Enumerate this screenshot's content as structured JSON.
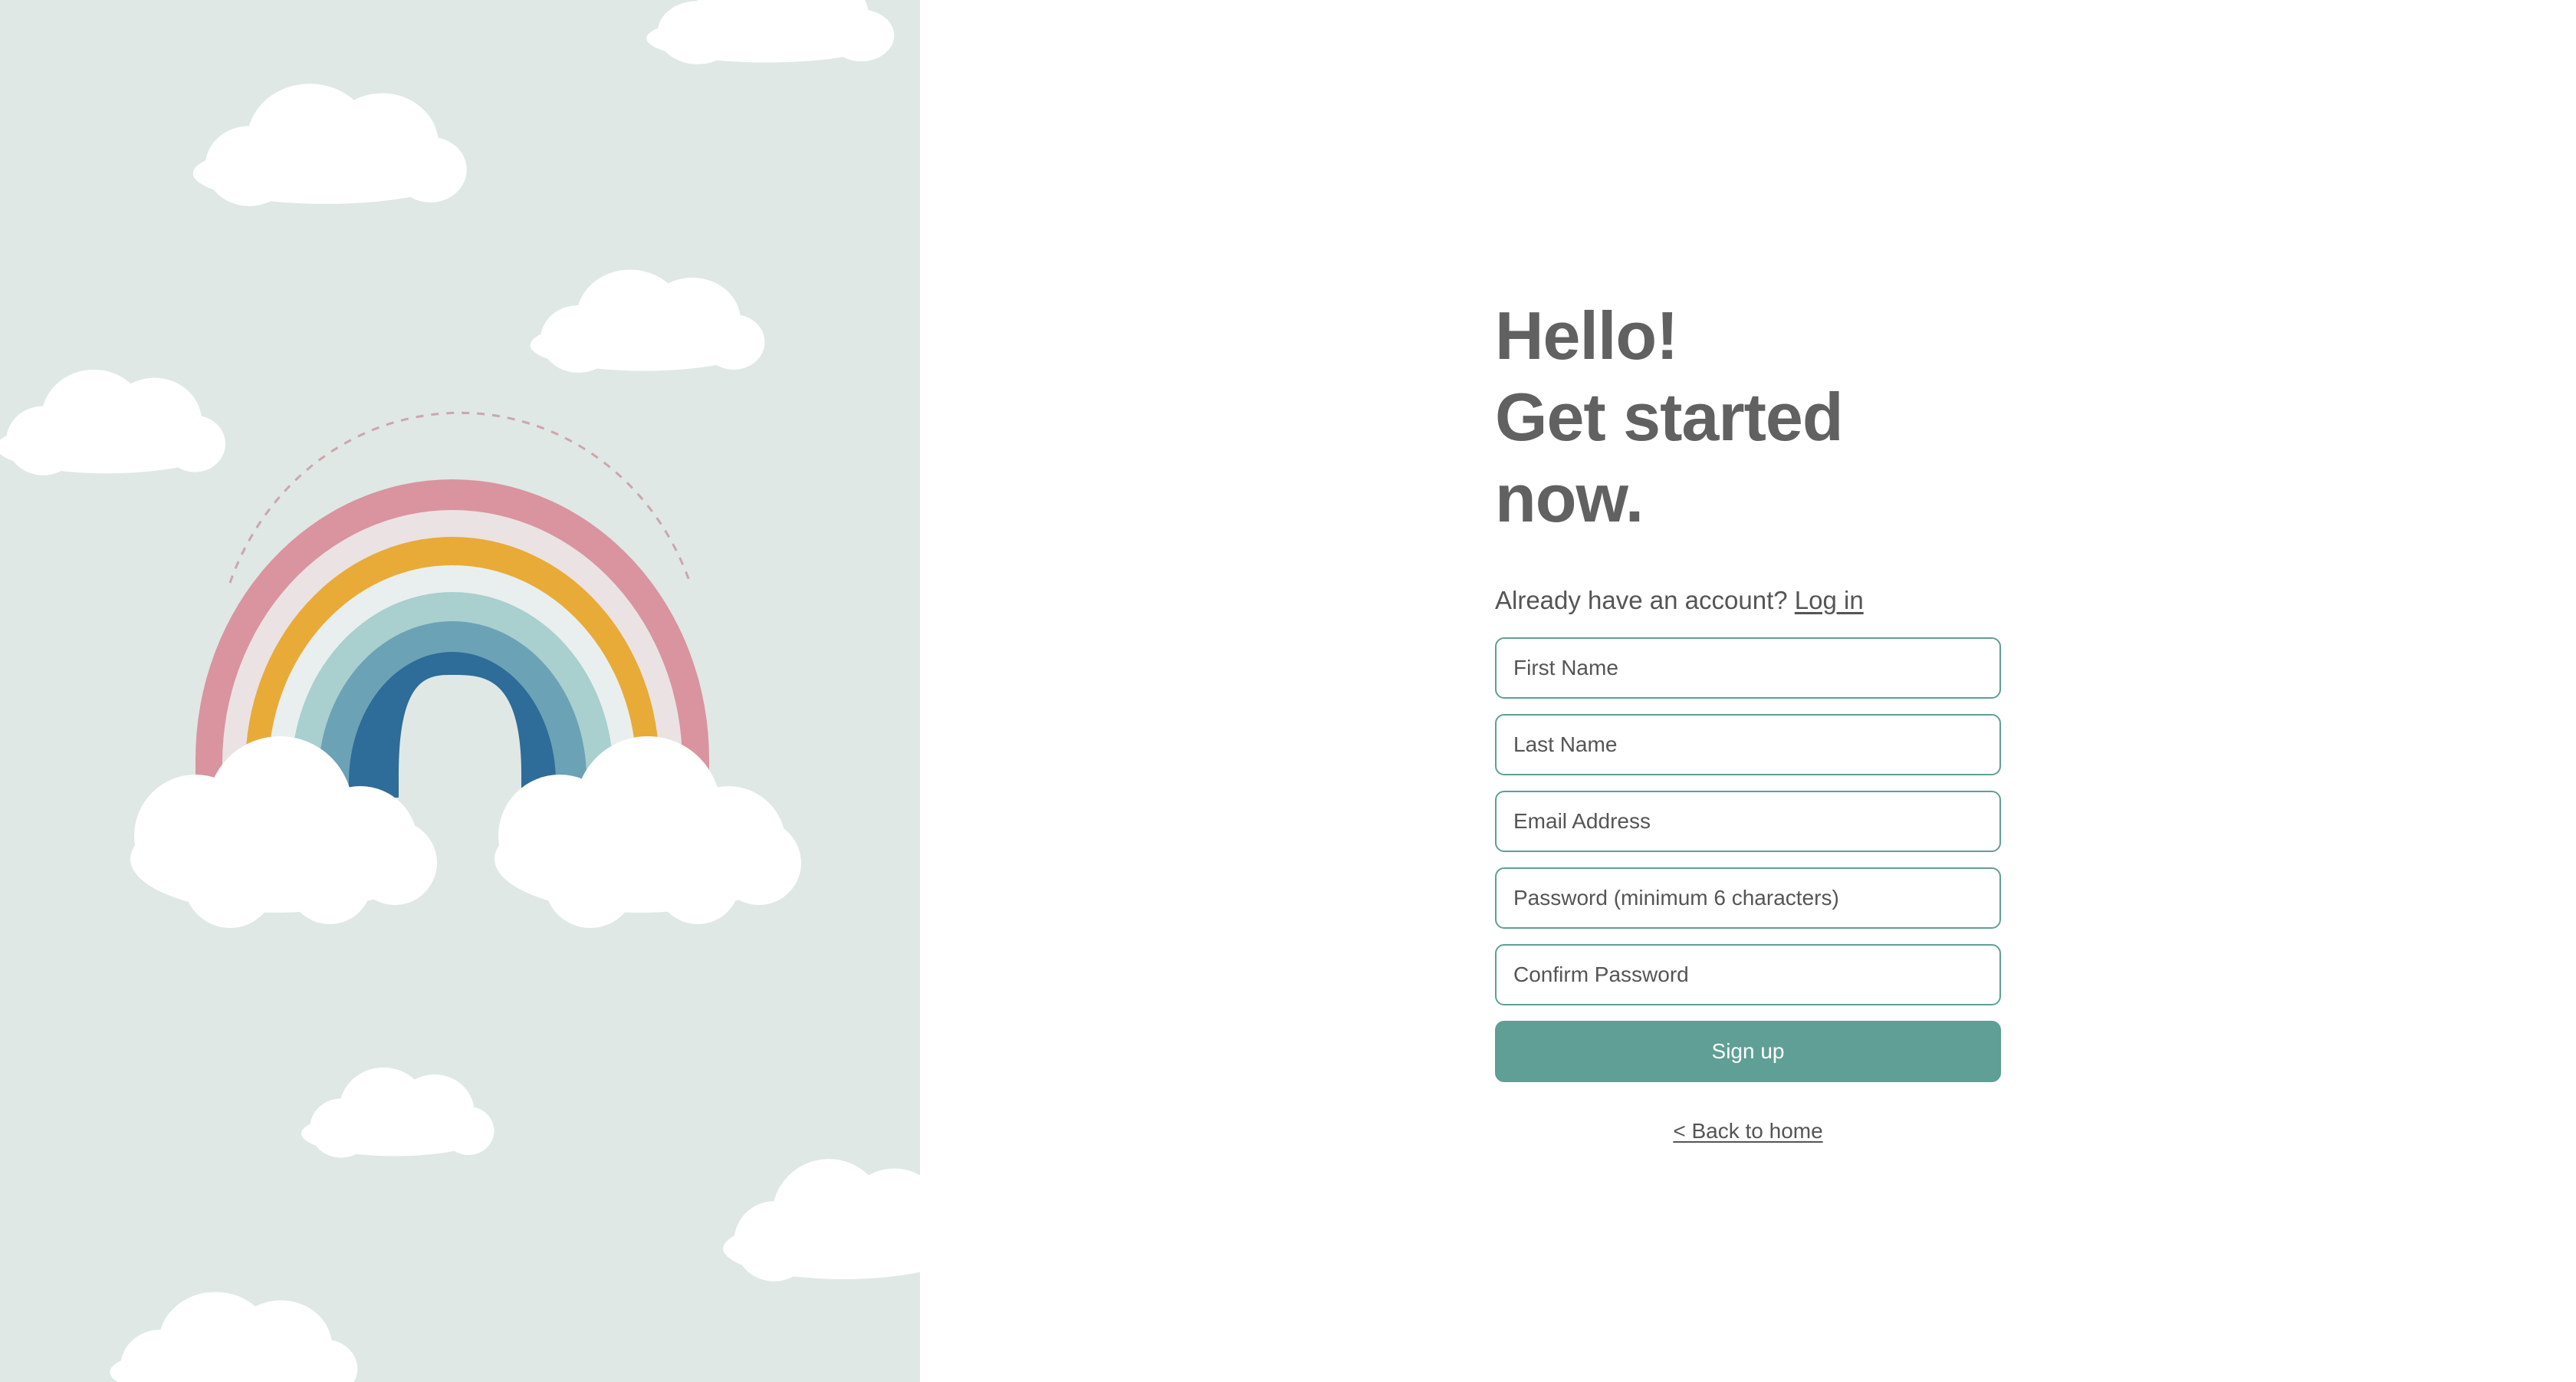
{
  "colors": {
    "panel_background": "#dfe8e5",
    "accent": "#5f9f95",
    "heading_text": "#616161",
    "body_text": "#555555"
  },
  "illustration": {
    "rainbow_icon": "rainbow-with-clouds",
    "cloud_icon": "cloud"
  },
  "header": {
    "line1": "Hello!",
    "line2": "Get started now."
  },
  "account": {
    "prompt": "Already have an account?",
    "login_link": "Log in"
  },
  "form": {
    "first_name_placeholder": "First Name",
    "last_name_placeholder": "Last Name",
    "email_placeholder": "Email Address",
    "password_placeholder": "Password (minimum 6 characters)",
    "confirm_password_placeholder": "Confirm Password",
    "submit_label": "Sign up"
  },
  "footer": {
    "back_link": "< Back to home"
  }
}
